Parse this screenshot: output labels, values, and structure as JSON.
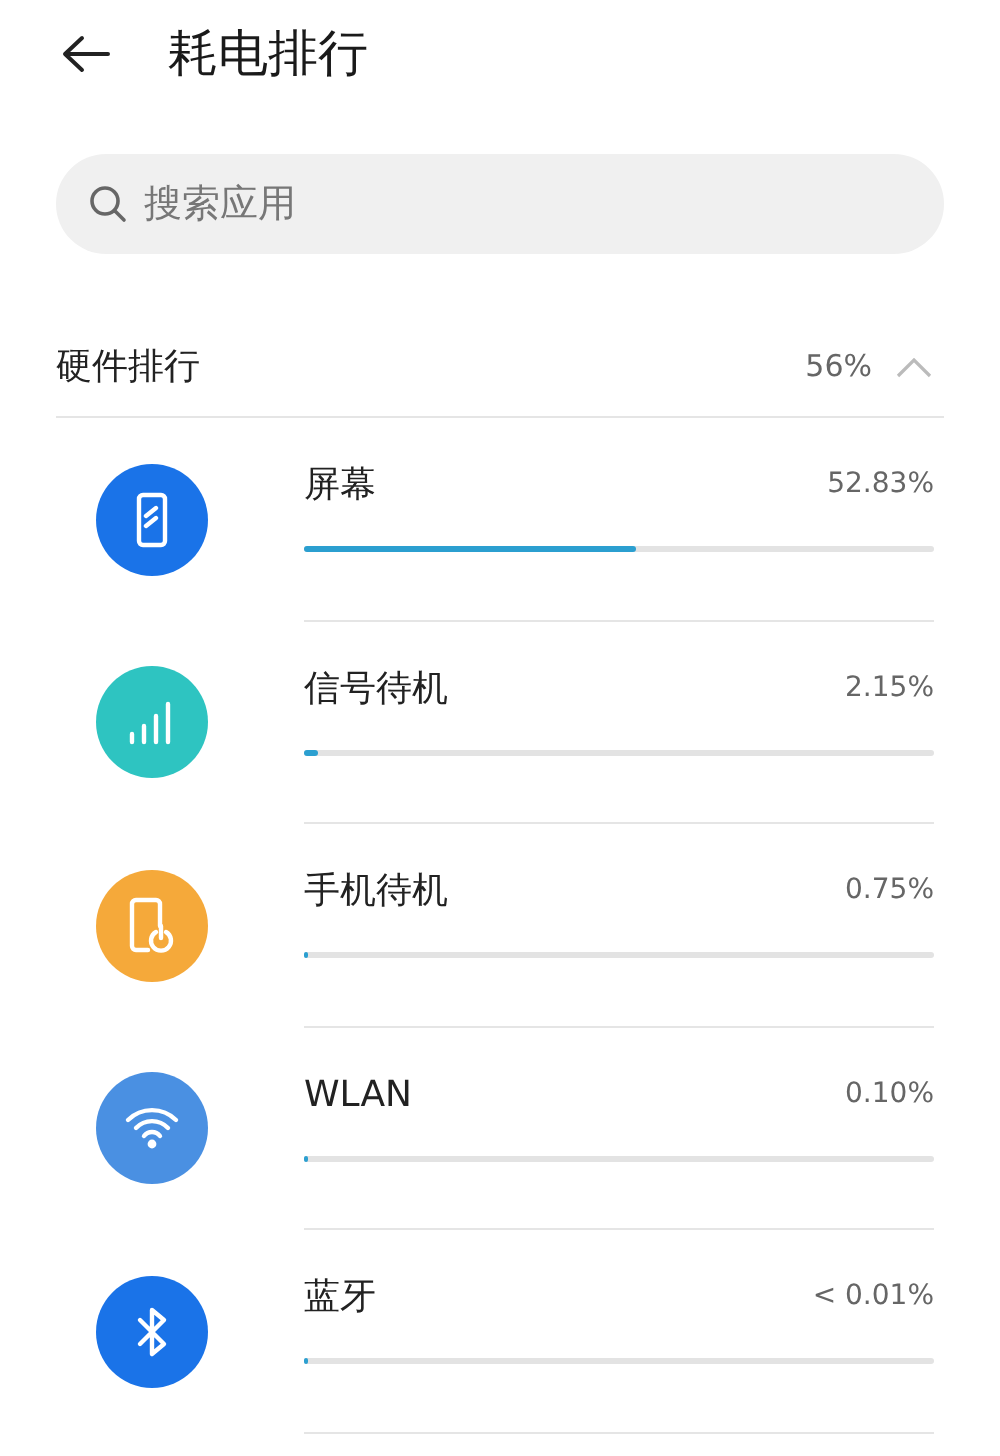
{
  "header": {
    "title": "耗电排行"
  },
  "search": {
    "placeholder": "搜索应用"
  },
  "section": {
    "title": "硬件排行",
    "value": "56%",
    "expanded": true
  },
  "items": [
    {
      "kind": "screen",
      "color": "#1a73e8",
      "name": "屏幕",
      "reading": "52.83%",
      "level": 0.5283
    },
    {
      "kind": "signal",
      "color": "#2ec4c1",
      "name": "信号待机",
      "reading": "2.15%",
      "level": 0.0215
    },
    {
      "kind": "standby",
      "color": "#f5a93a",
      "name": "手机待机",
      "reading": "0.75%",
      "level": 0.0075
    },
    {
      "kind": "wifi",
      "color": "#4a90e2",
      "name": "WLAN",
      "reading": "0.10%",
      "level": 0.001
    },
    {
      "kind": "bluetooth",
      "color": "#1a73e8",
      "name": "蓝牙",
      "reading": "< 0.01%",
      "level": 0.0001
    }
  ]
}
